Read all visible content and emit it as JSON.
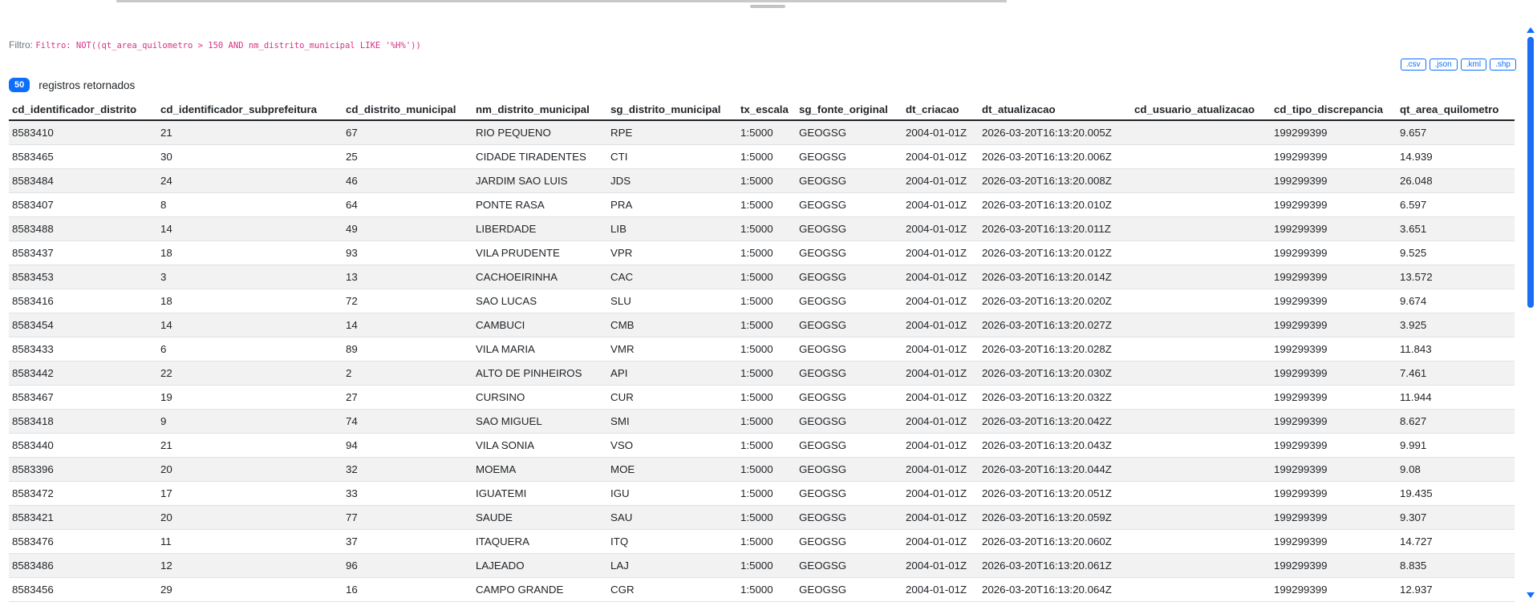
{
  "filter": {
    "label": "Filtro:",
    "expression": "Filtro: NOT((qt_area_quilometro > 150 AND nm_distrito_municipal LIKE '%H%'))"
  },
  "exports": [
    ".csv",
    ".json",
    ".kml",
    ".shp"
  ],
  "result": {
    "count": "50",
    "label": "registros retornados"
  },
  "table": {
    "columns": [
      "cd_identificador_distrito",
      "cd_identificador_subprefeitura",
      "cd_distrito_municipal",
      "nm_distrito_municipal",
      "sg_distrito_municipal",
      "tx_escala",
      "sg_fonte_original",
      "dt_criacao",
      "dt_atualizacao",
      "cd_usuario_atualizacao",
      "cd_tipo_discrepancia",
      "qt_area_quilometro"
    ],
    "rows": [
      [
        "8583410",
        "21",
        "67",
        "RIO PEQUENO",
        "RPE",
        "1:5000",
        "GEOGSG",
        "2004-01-01Z",
        "2026-03-20T16:13:20.005Z",
        "",
        "199299399",
        "9.657"
      ],
      [
        "8583465",
        "30",
        "25",
        "CIDADE TIRADENTES",
        "CTI",
        "1:5000",
        "GEOGSG",
        "2004-01-01Z",
        "2026-03-20T16:13:20.006Z",
        "",
        "199299399",
        "14.939"
      ],
      [
        "8583484",
        "24",
        "46",
        "JARDIM SAO LUIS",
        "JDS",
        "1:5000",
        "GEOGSG",
        "2004-01-01Z",
        "2026-03-20T16:13:20.008Z",
        "",
        "199299399",
        "26.048"
      ],
      [
        "8583407",
        "8",
        "64",
        "PONTE RASA",
        "PRA",
        "1:5000",
        "GEOGSG",
        "2004-01-01Z",
        "2026-03-20T16:13:20.010Z",
        "",
        "199299399",
        "6.597"
      ],
      [
        "8583488",
        "14",
        "49",
        "LIBERDADE",
        "LIB",
        "1:5000",
        "GEOGSG",
        "2004-01-01Z",
        "2026-03-20T16:13:20.011Z",
        "",
        "199299399",
        "3.651"
      ],
      [
        "8583437",
        "18",
        "93",
        "VILA PRUDENTE",
        "VPR",
        "1:5000",
        "GEOGSG",
        "2004-01-01Z",
        "2026-03-20T16:13:20.012Z",
        "",
        "199299399",
        "9.525"
      ],
      [
        "8583453",
        "3",
        "13",
        "CACHOEIRINHA",
        "CAC",
        "1:5000",
        "GEOGSG",
        "2004-01-01Z",
        "2026-03-20T16:13:20.014Z",
        "",
        "199299399",
        "13.572"
      ],
      [
        "8583416",
        "18",
        "72",
        "SAO LUCAS",
        "SLU",
        "1:5000",
        "GEOGSG",
        "2004-01-01Z",
        "2026-03-20T16:13:20.020Z",
        "",
        "199299399",
        "9.674"
      ],
      [
        "8583454",
        "14",
        "14",
        "CAMBUCI",
        "CMB",
        "1:5000",
        "GEOGSG",
        "2004-01-01Z",
        "2026-03-20T16:13:20.027Z",
        "",
        "199299399",
        "3.925"
      ],
      [
        "8583433",
        "6",
        "89",
        "VILA MARIA",
        "VMR",
        "1:5000",
        "GEOGSG",
        "2004-01-01Z",
        "2026-03-20T16:13:20.028Z",
        "",
        "199299399",
        "11.843"
      ],
      [
        "8583442",
        "22",
        "2",
        "ALTO DE PINHEIROS",
        "API",
        "1:5000",
        "GEOGSG",
        "2004-01-01Z",
        "2026-03-20T16:13:20.030Z",
        "",
        "199299399",
        "7.461"
      ],
      [
        "8583467",
        "19",
        "27",
        "CURSINO",
        "CUR",
        "1:5000",
        "GEOGSG",
        "2004-01-01Z",
        "2026-03-20T16:13:20.032Z",
        "",
        "199299399",
        "11.944"
      ],
      [
        "8583418",
        "9",
        "74",
        "SAO MIGUEL",
        "SMI",
        "1:5000",
        "GEOGSG",
        "2004-01-01Z",
        "2026-03-20T16:13:20.042Z",
        "",
        "199299399",
        "8.627"
      ],
      [
        "8583440",
        "21",
        "94",
        "VILA SONIA",
        "VSO",
        "1:5000",
        "GEOGSG",
        "2004-01-01Z",
        "2026-03-20T16:13:20.043Z",
        "",
        "199299399",
        "9.991"
      ],
      [
        "8583396",
        "20",
        "32",
        "MOEMA",
        "MOE",
        "1:5000",
        "GEOGSG",
        "2004-01-01Z",
        "2026-03-20T16:13:20.044Z",
        "",
        "199299399",
        "9.08"
      ],
      [
        "8583472",
        "17",
        "33",
        "IGUATEMI",
        "IGU",
        "1:5000",
        "GEOGSG",
        "2004-01-01Z",
        "2026-03-20T16:13:20.051Z",
        "",
        "199299399",
        "19.435"
      ],
      [
        "8583421",
        "20",
        "77",
        "SAUDE",
        "SAU",
        "1:5000",
        "GEOGSG",
        "2004-01-01Z",
        "2026-03-20T16:13:20.059Z",
        "",
        "199299399",
        "9.307"
      ],
      [
        "8583476",
        "11",
        "37",
        "ITAQUERA",
        "ITQ",
        "1:5000",
        "GEOGSG",
        "2004-01-01Z",
        "2026-03-20T16:13:20.060Z",
        "",
        "199299399",
        "14.727"
      ],
      [
        "8583486",
        "12",
        "96",
        "LAJEADO",
        "LAJ",
        "1:5000",
        "GEOGSG",
        "2004-01-01Z",
        "2026-03-20T16:13:20.061Z",
        "",
        "199299399",
        "8.835"
      ],
      [
        "8583456",
        "29",
        "16",
        "CAMPO GRANDE",
        "CGR",
        "1:5000",
        "GEOGSG",
        "2004-01-01Z",
        "2026-03-20T16:13:20.064Z",
        "",
        "199299399",
        "12.937"
      ]
    ]
  },
  "colors": {
    "accent": "#0d6efd",
    "code": "#d63384",
    "stripe": "#f2f2f2"
  }
}
